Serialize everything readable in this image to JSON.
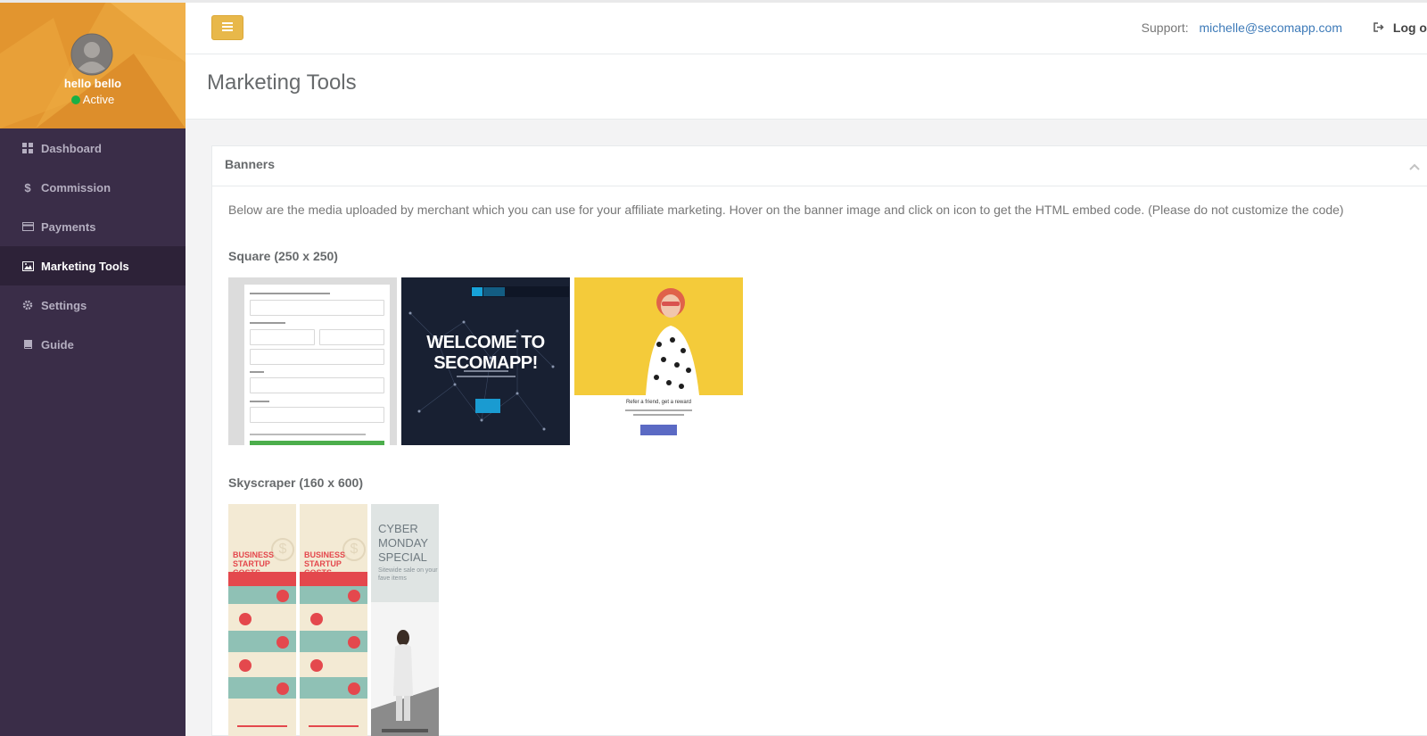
{
  "sidebar": {
    "profile": {
      "name": "hello bello",
      "status": "Active"
    },
    "items": [
      {
        "label": "Dashboard",
        "icon": "dashboard-icon",
        "active": false
      },
      {
        "label": "Commission",
        "icon": "dollar-icon",
        "active": false
      },
      {
        "label": "Payments",
        "icon": "credit-card-icon",
        "active": false
      },
      {
        "label": "Marketing Tools",
        "icon": "image-icon",
        "active": true
      },
      {
        "label": "Settings",
        "icon": "gear-icon",
        "active": false
      },
      {
        "label": "Guide",
        "icon": "book-icon",
        "active": false
      }
    ]
  },
  "topbar": {
    "support_label": "Support:",
    "support_email": "michelle@secomapp.com",
    "logout_label": "Log out"
  },
  "page": {
    "title": "Marketing Tools"
  },
  "banners": {
    "heading": "Banners",
    "description": "Below are the media uploaded by merchant which you can use for your affiliate marketing. Hover on the banner image and click on icon to get the HTML embed code. (Please do not customize the code)",
    "square_title": "Square (250 x 250)",
    "skyscraper_title": "Skyscraper (160 x 600)",
    "square_items": {
      "welcome_text": "WELCOME TO SECOMAPP!",
      "refer_text": "Refer a friend, get a reward"
    },
    "skyscraper_items": {
      "business_title": "BUSINESS STARTUP COSTS",
      "cyber_title": "CYBER MONDAY SPECIAL",
      "cyber_sub": "Sitewide sale on your fave items"
    }
  },
  "colors": {
    "sidebar_bg": "#3a2d48",
    "sidebar_active": "#2d2238",
    "profile_bg": "#e8a23a",
    "menu_button": "#e8b84a",
    "link": "#3d7ab8",
    "status_active": "#1ab045"
  }
}
